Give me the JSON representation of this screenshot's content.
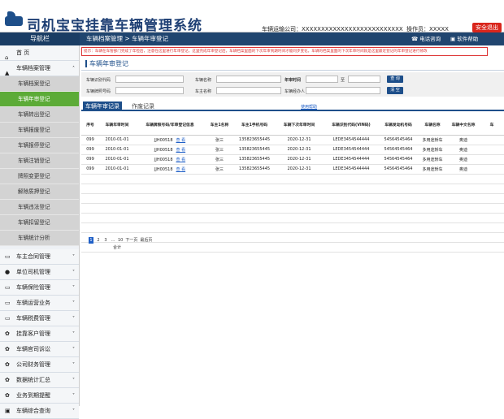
{
  "header": {
    "title": "司机宝宝挂靠车辆管理系统",
    "company": "车辆运输公司：XXXXXXXXXXXXXXXXXXXXXXXXXX",
    "operator": "操作员：XXXXX",
    "logout": "安全退出",
    "phone": "电话咨询",
    "help": "软件帮助"
  },
  "sidebar": {
    "title": "导航栏",
    "home": "首 页",
    "group_open": "车辆档案管理",
    "sub": [
      "车辆档案登记",
      "车辆年审登记",
      "车辆转出登记",
      "车辆报废登记",
      "车辆报停登记",
      "车辆注销登记",
      "牌照变更登记",
      "解除质押登记",
      "车辆违法登记",
      "车辆扣留登记",
      "车辆统计分析"
    ],
    "groups": [
      "车主合同管理",
      "单位司机管理",
      "车辆保险管理",
      "车辆运营业务",
      "车辆税费管理",
      "挂靠客户管理",
      "车辆官司诉讼",
      "公司财务管理",
      "数据统计汇总",
      "业务到期提醒",
      "车辆综合查询"
    ]
  },
  "main": {
    "breadcrumb": "车辆档案管理 > 车辆年审登记",
    "notice": "提示：车辆在车管部门完成了年检后，注意在这里进行年审登记，这里完成年审登记后，车辆档案里面的下次年审到期时间才能同步变化，车辆的档案里面的下次年审时间就是这里最近登记的年审登记进行修改",
    "section_title": "车辆年审登记",
    "filter": {
      "vin_label": "车辆识别代码",
      "plate_label": "车辆牌照号码",
      "name_label": "车辆名称",
      "owner_label": "车主名称",
      "date_label": "年审时间",
      "date_to": "至",
      "manager_label": "车辆经办人",
      "query": "查 询",
      "clear": "清 空"
    },
    "tab_active": "车辆年审记录",
    "tab_other": "作废记录",
    "usage_link": "使用帮助",
    "columns": [
      "序号",
      "车辆年审时间",
      "车辆牌照号码/年审登记信息",
      "车主1名称",
      "车主1手机号码",
      "车辆下次年审时间",
      "车辆识别代码(VIN码)",
      "车辆发动机号码",
      "车辆名称",
      "车辆中文名称",
      "车"
    ],
    "rows": [
      [
        "099",
        "2010-01-01",
        "JJH00518",
        "查 看",
        "张三",
        "135823655445",
        "2020-12-31",
        "LEDE3454544444",
        "54564545464",
        "多用途轿车",
        "奥迪"
      ],
      [
        "099",
        "2010-01-01",
        "JJH00518",
        "查 看",
        "张三",
        "135823655445",
        "2020-12-31",
        "LEDE3454544444",
        "54564545464",
        "多用途轿车",
        "奥迪"
      ],
      [
        "099",
        "2010-01-01",
        "JJH00518",
        "查 看",
        "张三",
        "135823655445",
        "2020-12-31",
        "LEDE3454544444",
        "54564545464",
        "多用途轿车",
        "奥迪"
      ],
      [
        "099",
        "2010-01-01",
        "JJH00518",
        "查 看",
        "张三",
        "135823655445",
        "2020-12-31",
        "LEDE3454544444",
        "54564545464",
        "多用途轿车",
        "奥迪"
      ]
    ],
    "total_label": "合计",
    "pager": [
      "1",
      "2",
      "3",
      "...",
      "10",
      "下一页",
      "最后页"
    ]
  },
  "colors": {
    "brand": "#1e4f8a",
    "active": "#5cab37",
    "danger": "#d9261c"
  }
}
